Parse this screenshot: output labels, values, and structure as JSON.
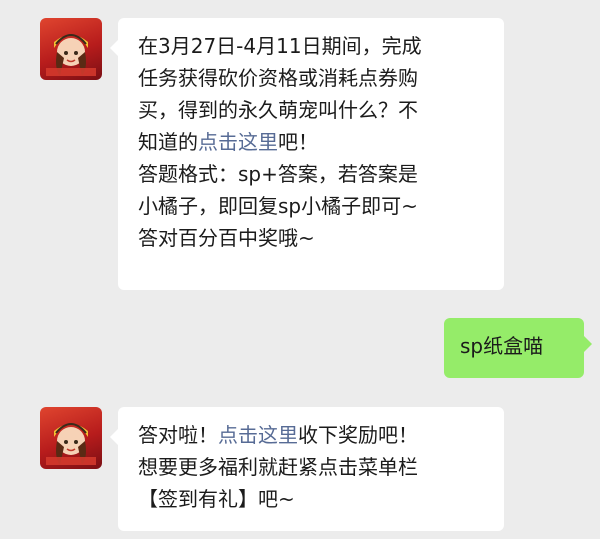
{
  "messages": [
    {
      "sender": "bot",
      "lines": [
        "在3月27日-4月11日期间，完成",
        "任务获得砍价资格或消耗点券购",
        "买，得到的永久萌宠叫什么？不"
      ],
      "line4_prefix": "知道的",
      "line4_link": "点击这里",
      "line4_suffix": "吧！",
      "lines_after": [
        "答题格式：sp+答案，若答案是",
        "小橘子，即回复sp小橘子即可~",
        "答对百分百中奖哦~"
      ]
    },
    {
      "sender": "me",
      "text": "sp纸盒喵"
    },
    {
      "sender": "bot",
      "line1_prefix": "答对啦！",
      "line1_link": "点击这里",
      "line1_suffix": "收下奖励吧！",
      "lines_after": [
        "想要更多福利就赶紧点击菜单栏",
        "【签到有礼】吧~"
      ]
    }
  ],
  "colors": {
    "background": "#ececec",
    "bubble_bot": "#ffffff",
    "bubble_me": "#95ec69",
    "link": "#576b95"
  }
}
